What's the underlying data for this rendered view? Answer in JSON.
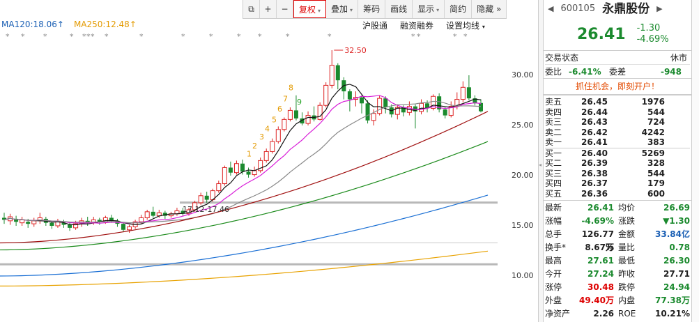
{
  "toolbar": {
    "buttons": [
      "复权",
      "叠加",
      "筹码",
      "画线",
      "显示",
      "简约",
      "隐藏"
    ],
    "overflow": "»"
  },
  "ma_lines": {
    "ma120": "MA120:18.06",
    "ma250": "MA250:12.48"
  },
  "sub_links": [
    "沪股通",
    "融资融券",
    "设置均线"
  ],
  "chart": {
    "price_labels": [
      "30.00",
      "25.00",
      "20.00",
      "15.00",
      "10.00"
    ],
    "high_marker": "32.50",
    "support_label": "17.12-17.46",
    "td_numbers": [
      "1",
      "2",
      "3",
      "4",
      "5",
      "6",
      "7",
      "8",
      "9"
    ]
  },
  "colors": {
    "up": "#dd2222",
    "down": "#1b8a2e",
    "ma5": "#111111",
    "ma10": "#d81bd8",
    "ma20": "#888888",
    "ma60": "#a01010",
    "ma120": "#1a8a1a",
    "ma250": "#1a6fd4",
    "ma_long": "#e8a200"
  },
  "quote": {
    "code": "600105",
    "name": "永鼎股份",
    "price": "26.41",
    "change": "-1.30",
    "change_pct": "-4.69%"
  },
  "status": {
    "label": "交易状态",
    "value": "休市",
    "weibi_label": "委比",
    "weibi": "-6.41%",
    "weicha_label": "委差",
    "weicha": "-948"
  },
  "promo": "抓住机会，即刻开户！",
  "order_book": {
    "asks": [
      {
        "label": "卖五",
        "price": "26.45",
        "vol": "1976"
      },
      {
        "label": "卖四",
        "price": "26.44",
        "vol": "544"
      },
      {
        "label": "卖三",
        "price": "26.43",
        "vol": "724"
      },
      {
        "label": "卖二",
        "price": "26.42",
        "vol": "4242"
      },
      {
        "label": "卖一",
        "price": "26.41",
        "vol": "383"
      }
    ],
    "bids": [
      {
        "label": "买一",
        "price": "26.40",
        "vol": "5269"
      },
      {
        "label": "买二",
        "price": "26.39",
        "vol": "328"
      },
      {
        "label": "买三",
        "price": "26.38",
        "vol": "544"
      },
      {
        "label": "买四",
        "price": "26.37",
        "vol": "179"
      },
      {
        "label": "买五",
        "price": "26.36",
        "vol": "600"
      }
    ]
  },
  "stats": [
    {
      "k1": "最新",
      "v1": "26.41",
      "c1": "green",
      "k2": "均价",
      "v2": "26.69",
      "c2": "green"
    },
    {
      "k1": "涨幅",
      "v1": "-4.69%",
      "c1": "green",
      "k2": "涨跌",
      "v2": "▼1.30",
      "c2": "green"
    },
    {
      "k1": "总手",
      "v1": "126.77万",
      "c1": "",
      "k2": "金额",
      "v2": "33.84亿",
      "c2": "blue"
    },
    {
      "k1": "换手*",
      "v1": "8.67%",
      "c1": "",
      "k2": "量比",
      "v2": "0.78",
      "c2": "green"
    },
    {
      "k1": "最高",
      "v1": "27.61",
      "c1": "green",
      "k2": "最低",
      "v2": "26.30",
      "c2": "green"
    },
    {
      "k1": "今开",
      "v1": "27.24",
      "c1": "green",
      "k2": "昨收",
      "v2": "27.71",
      "c2": ""
    },
    {
      "k1": "涨停",
      "v1": "30.48",
      "c1": "red",
      "k2": "跌停",
      "v2": "24.94",
      "c2": "green"
    },
    {
      "k1": "外盘",
      "v1": "49.40万",
      "c1": "red",
      "k2": "内盘",
      "v2": "77.38万",
      "c2": "green"
    },
    {
      "k1": "净资产",
      "v1": "2.26",
      "c1": "",
      "k2": "ROE",
      "v2": "10.21%",
      "c2": ""
    }
  ]
}
